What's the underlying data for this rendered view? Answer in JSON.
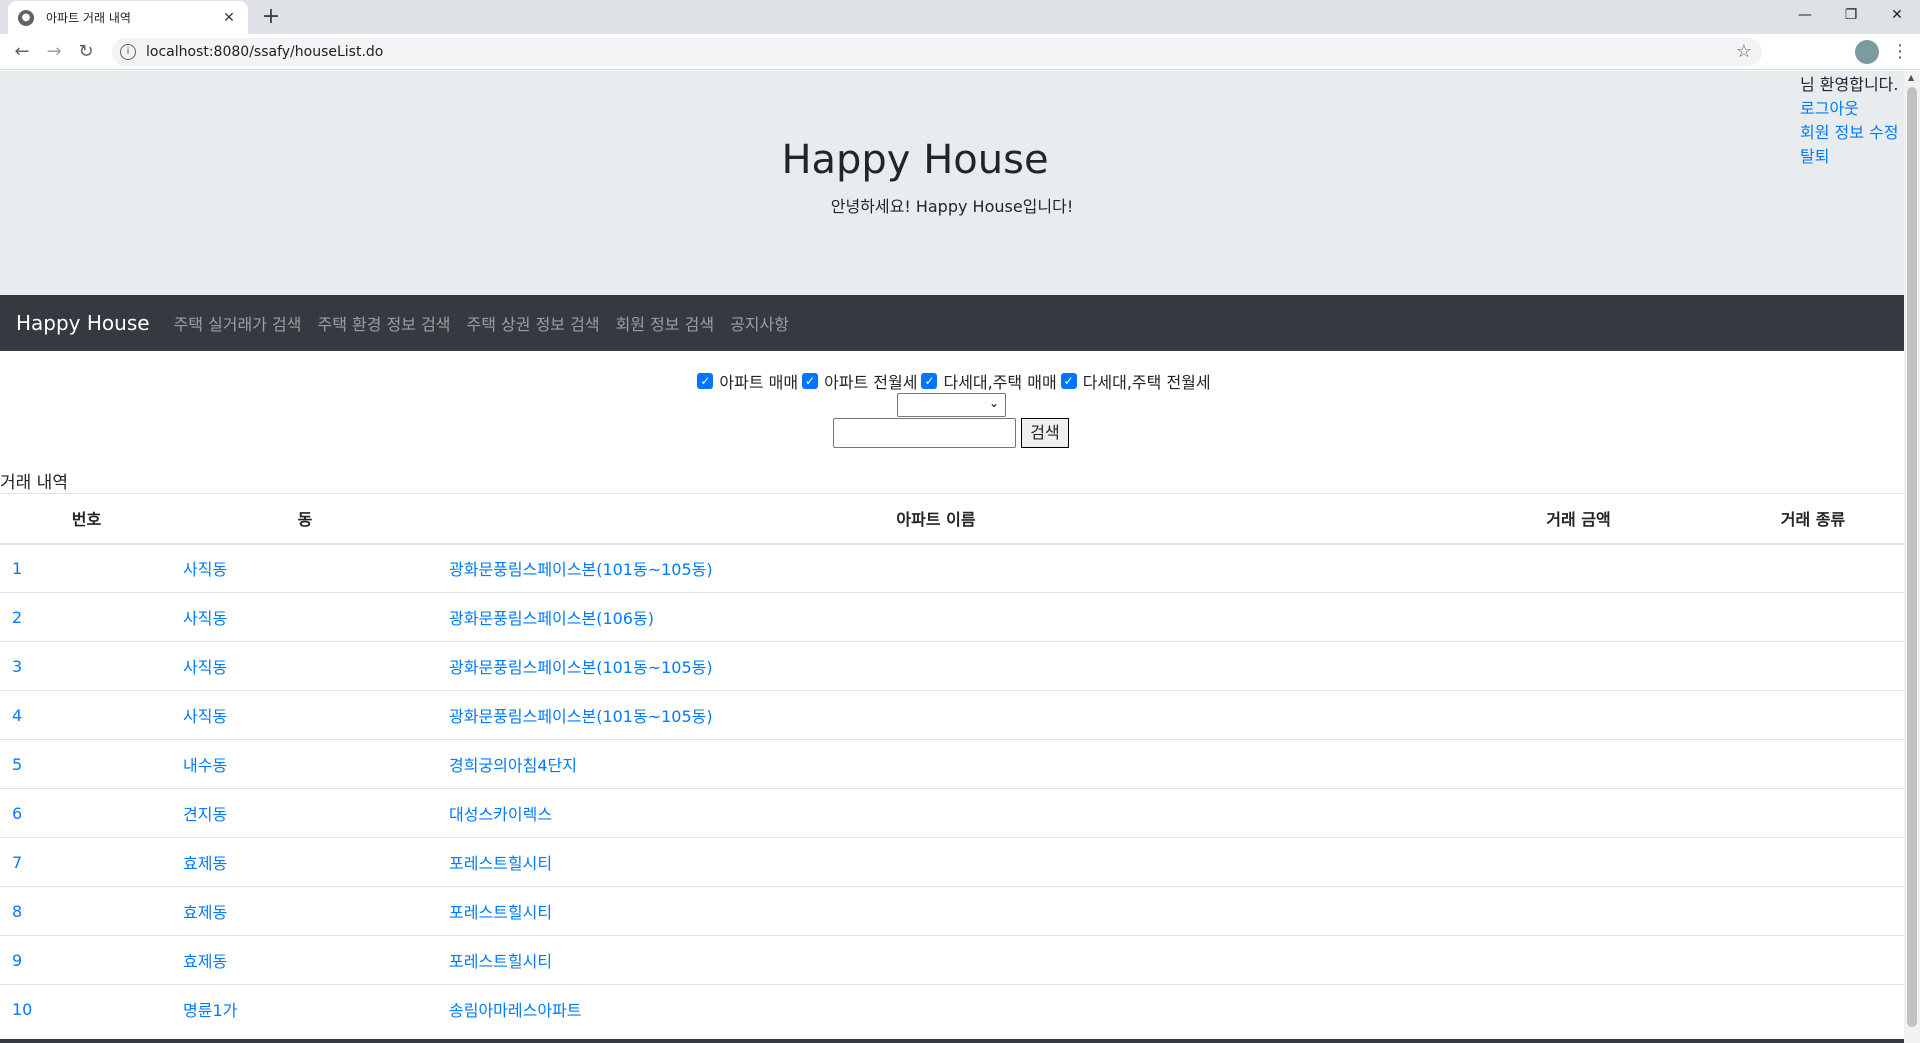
{
  "browser": {
    "tab_title": "아파트 거래 내역",
    "url": "localhost:8080/ssafy/houseList.do"
  },
  "header": {
    "title": "Happy House",
    "subtitle": "안녕하세요! Happy House입니다!",
    "welcome": "님 환영합니다.",
    "logout": "로그아웃",
    "edit_profile": "회원 정보 수정",
    "withdraw": "탈퇴"
  },
  "navbar": {
    "brand": "Happy House",
    "items": [
      "주택 실거래가 검색",
      "주택 환경 정보 검색",
      "주택 상권 정보 검색",
      "회원 정보 검색",
      "공지사항"
    ]
  },
  "filters": {
    "options": [
      "아파트 매매",
      "아파트 전월세",
      "다세대,주택 매매",
      "다세대,주택 전월세"
    ],
    "search_button": "검색",
    "search_value": "",
    "select_value": ""
  },
  "table": {
    "title": "거래 내역",
    "headers": [
      "번호",
      "동",
      "아파트 이름",
      "거래 금액",
      "거래 종류"
    ],
    "rows": [
      [
        "1",
        "사직동",
        "광화문풍림스페이스본(101동~105동)",
        "",
        ""
      ],
      [
        "2",
        "사직동",
        "광화문풍림스페이스본(106동)",
        "",
        ""
      ],
      [
        "3",
        "사직동",
        "광화문풍림스페이스본(101동~105동)",
        "",
        ""
      ],
      [
        "4",
        "사직동",
        "광화문풍림스페이스본(101동~105동)",
        "",
        ""
      ],
      [
        "5",
        "내수동",
        "경희궁의아침4단지",
        "",
        ""
      ],
      [
        "6",
        "견지동",
        "대성스카이렉스",
        "",
        ""
      ],
      [
        "7",
        "효제동",
        "포레스트힐시티",
        "",
        ""
      ],
      [
        "8",
        "효제동",
        "포레스트힐시티",
        "",
        ""
      ],
      [
        "9",
        "효제동",
        "포레스트힐시티",
        "",
        ""
      ],
      [
        "10",
        "명륜1가",
        "송림아마레스아파트",
        "",
        ""
      ]
    ]
  }
}
